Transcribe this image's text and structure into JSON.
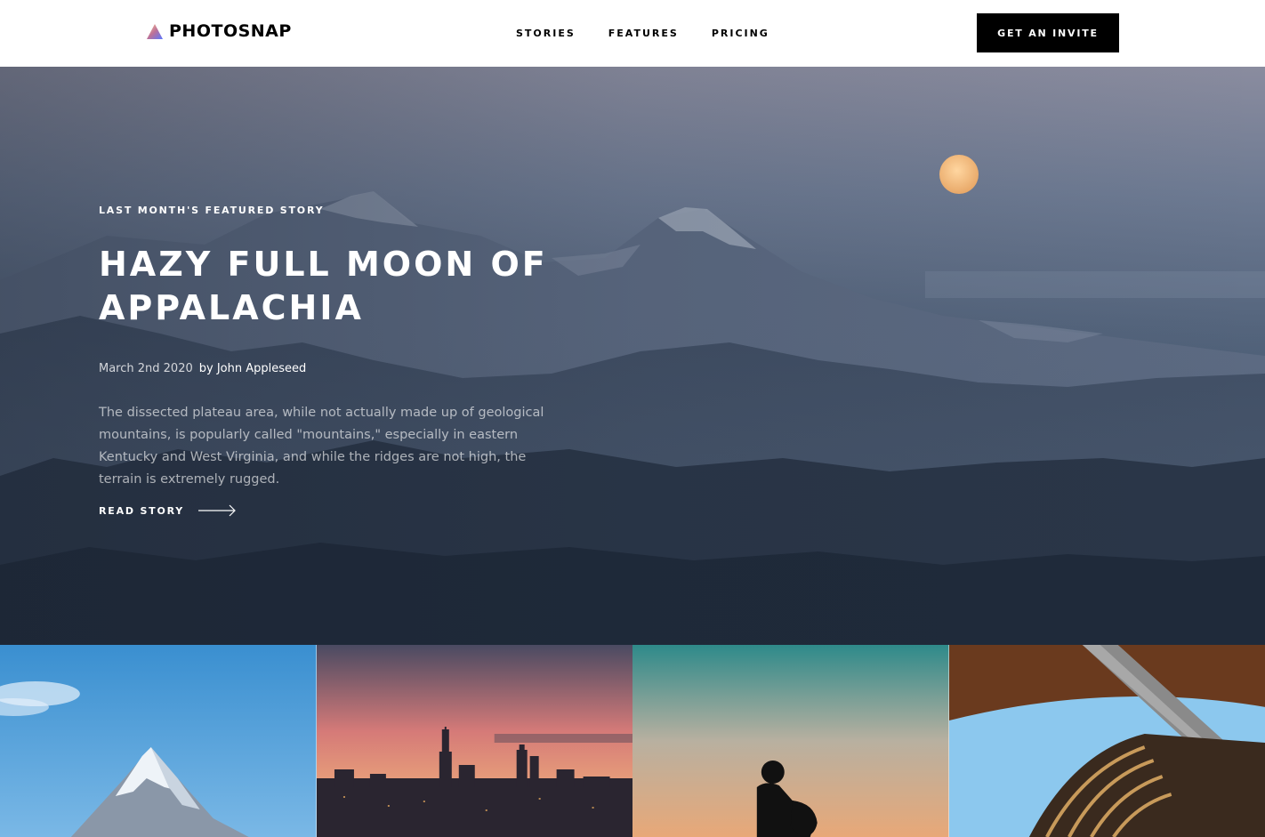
{
  "brand": {
    "name": "PHOTOSNAP",
    "logo_icon": "triangle-logo-icon"
  },
  "nav": {
    "items": [
      "STORIES",
      "FEATURES",
      "PRICING"
    ]
  },
  "header": {
    "cta_label": "GET AN INVITE"
  },
  "hero": {
    "eyebrow": "LAST MONTH'S FEATURED STORY",
    "title": "HAZY FULL MOON OF APPALACHIA",
    "date": "March 2nd 2020",
    "author": "by John Appleseed",
    "excerpt": "The dissected plateau area, while not actually made up of geological mountains, is popularly called \"mountains,\" especially in eastern Kentucky and West Virginia, and while the ridges are not high, the terrain is extremely rugged.",
    "cta_label": "READ STORY",
    "cta_icon": "arrow-right-icon"
  },
  "tiles": [
    {
      "image": "snowy-mountain-peak"
    },
    {
      "image": "city-skyline-sunset"
    },
    {
      "image": "hiker-silhouette-dusk"
    },
    {
      "image": "modern-building-curves"
    }
  ],
  "colors": {
    "accent_gradient": [
      "#FFC593",
      "#BC7198",
      "#5A77FF"
    ],
    "ink": "#000000",
    "paper": "#FFFFFF"
  }
}
